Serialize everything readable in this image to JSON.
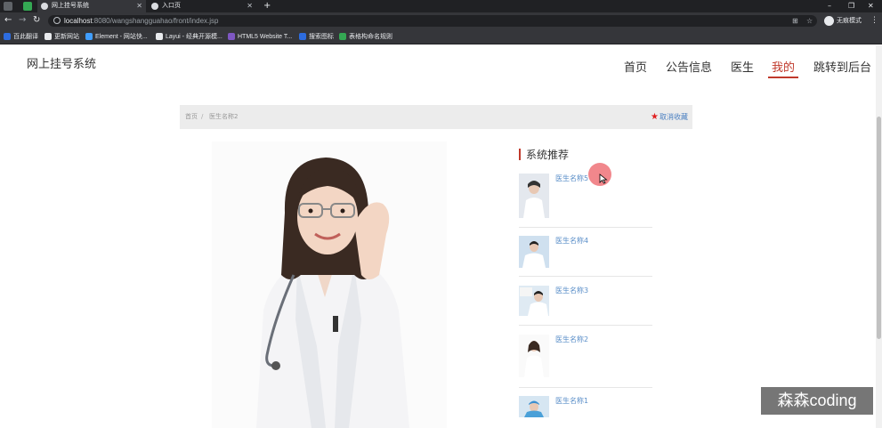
{
  "browser": {
    "tabs": [
      {
        "title": "网上挂号系统"
      },
      {
        "title": "入口页"
      }
    ],
    "url_host": "localhost",
    "url_path": ":8080/wangshangguahao/front/index.jsp",
    "profile_label": "无痕模式",
    "bookmarks": [
      {
        "label": "百此翻译",
        "color": "#2d6cdf"
      },
      {
        "label": "更新网站",
        "color": "#e8eaed"
      },
      {
        "label": "Element - 网站快...",
        "color": "#409eff"
      },
      {
        "label": "Layui - 经典开源模...",
        "color": "#e8eaed"
      },
      {
        "label": "HTML5 Website T...",
        "color": "#7e57c2"
      },
      {
        "label": "搜索图标",
        "color": "#2d6cdf"
      },
      {
        "label": "表格构命名规则",
        "color": "#34a853"
      }
    ]
  },
  "site": {
    "title": "网上挂号系统",
    "nav": [
      {
        "label": "首页"
      },
      {
        "label": "公告信息"
      },
      {
        "label": "医生"
      },
      {
        "label": "我的"
      },
      {
        "label": "跳转到后台"
      }
    ],
    "active_nav": "我的"
  },
  "breadcrumb": {
    "home": "首页",
    "separator": "/",
    "current": "医生名称2",
    "action_label": "取消收藏"
  },
  "recommend": {
    "title": "系统推荐",
    "items": [
      {
        "name": "医生名称5"
      },
      {
        "name": "医生名称4"
      },
      {
        "name": "医生名称3"
      },
      {
        "name": "医生名称2"
      },
      {
        "name": "医生名称1"
      }
    ]
  },
  "overlay": {
    "watermark": "森森coding"
  },
  "colors": {
    "accent": "#c0392b",
    "link": "#5b8fc9",
    "star": "#e02020"
  }
}
